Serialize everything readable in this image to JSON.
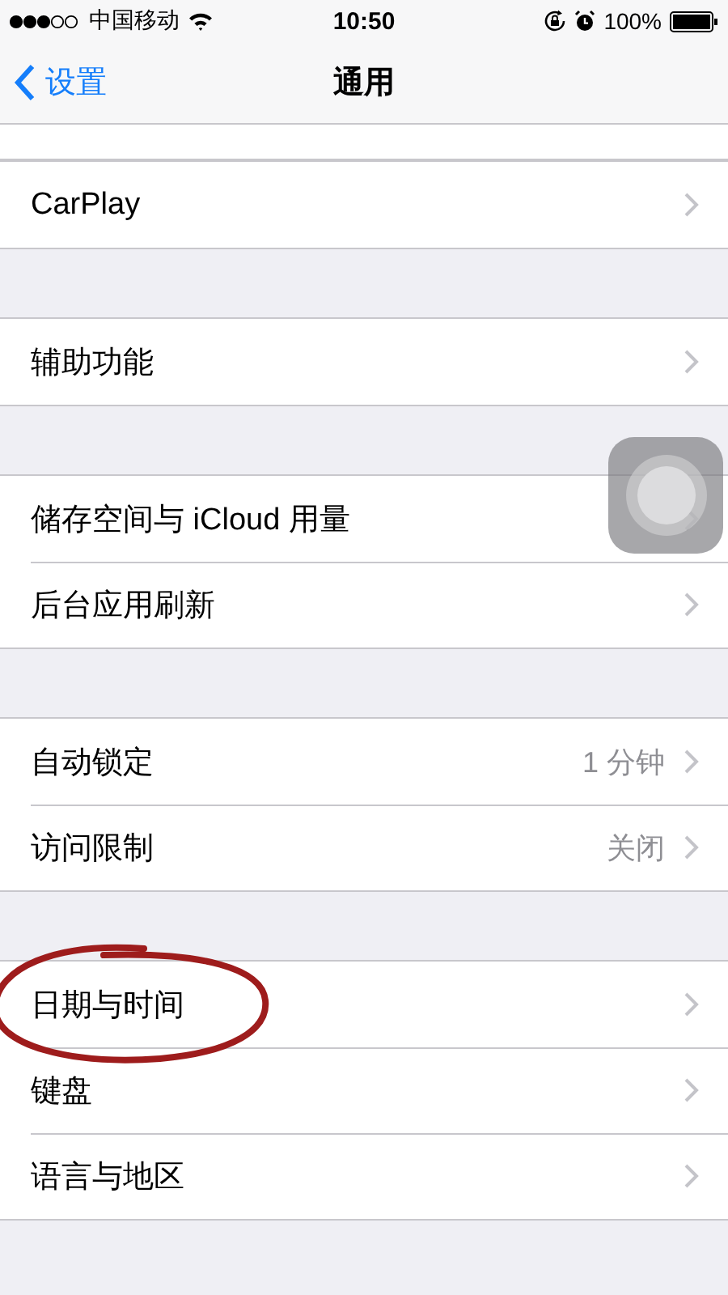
{
  "status_bar": {
    "carrier": "中国移动",
    "time": "10:50",
    "battery": "100%"
  },
  "nav": {
    "back": "设置",
    "title": "通用"
  },
  "groups": [
    {
      "rows": [
        {
          "label": "CarPlay",
          "circled": false
        }
      ]
    },
    {
      "rows": [
        {
          "label": "辅助功能",
          "circled": false
        }
      ]
    },
    {
      "rows": [
        {
          "label": "储存空间与 iCloud 用量",
          "circled": false
        },
        {
          "label": "后台应用刷新",
          "circled": false
        }
      ]
    },
    {
      "rows": [
        {
          "label": "自动锁定",
          "value": "1 分钟",
          "circled": false
        },
        {
          "label": "访问限制",
          "value": "关闭",
          "circled": false
        }
      ]
    },
    {
      "rows": [
        {
          "label": "日期与时间",
          "circled": true
        },
        {
          "label": "键盘",
          "circled": false
        },
        {
          "label": "语言与地区",
          "circled": false
        }
      ]
    }
  ],
  "assistive_touch": {
    "shown": true
  }
}
